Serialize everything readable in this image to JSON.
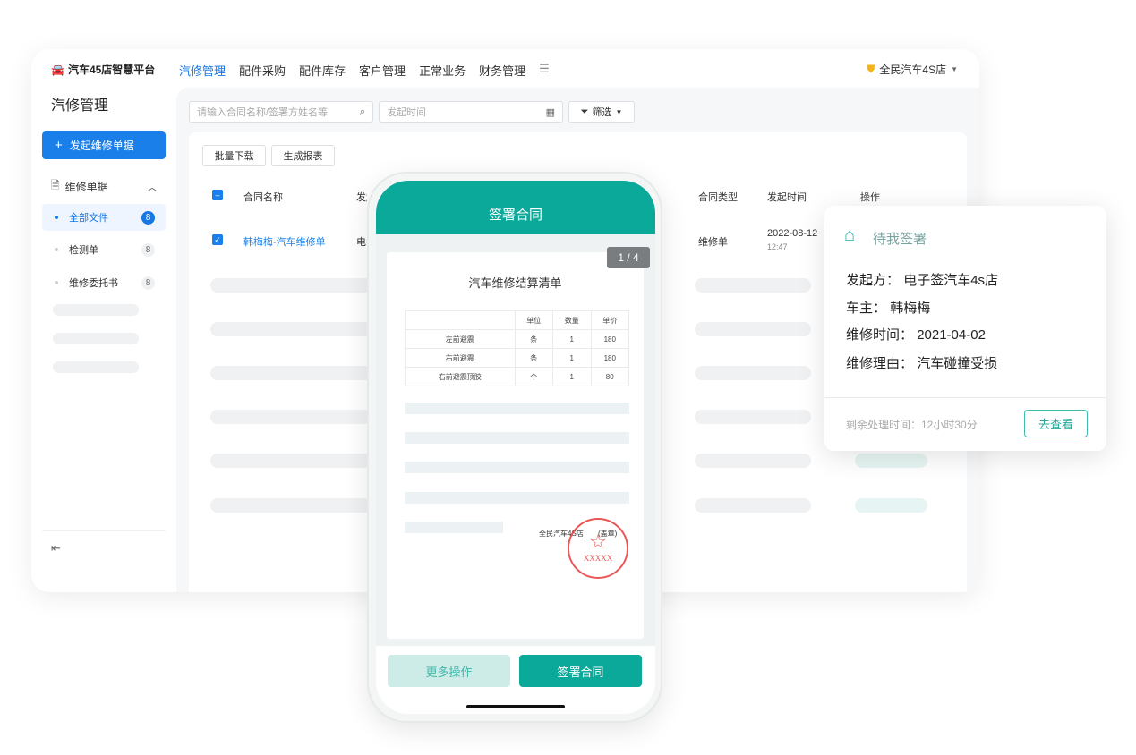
{
  "app": {
    "title": "汽车45店智慧平台",
    "nav": [
      "汽修管理",
      "配件采购",
      "配件库存",
      "客户管理",
      "正常业务",
      "财务管理"
    ],
    "shop": "全民汽车4S店"
  },
  "sidebar": {
    "title": "汽修管理",
    "new_button": "发起维修单据",
    "group": "维修单据",
    "items": [
      {
        "label": "全部文件",
        "count": "8"
      },
      {
        "label": "检测单",
        "count": "8"
      },
      {
        "label": "维修委托书",
        "count": "8"
      }
    ]
  },
  "filters": {
    "search_placeholder": "请输入合同名称/签署方姓名等",
    "date_placeholder": "发起时间",
    "filter": "筛选"
  },
  "toolbar": {
    "batch_download": "批量下载",
    "report": "生成报表"
  },
  "table": {
    "headers": [
      "合同名称",
      "发起方",
      "合同类型",
      "发起时间",
      "操作"
    ],
    "row": {
      "name": "韩梅梅-汽车维修单",
      "initiator": "电子签汽车4s店",
      "type": "维修单",
      "date": "2022-08-12",
      "time": "12:47"
    }
  },
  "phone": {
    "title": "签署合同",
    "pager": "1 / 4",
    "doc_title": "汽车维修结算清单",
    "doc_headers": [
      "",
      "单位",
      "数量",
      "单价"
    ],
    "doc_rows": [
      [
        "左前避震",
        "条",
        "1",
        "180"
      ],
      [
        "右前避震",
        "条",
        "1",
        "180"
      ],
      [
        "右前避震顶胶",
        "个",
        "1",
        "80"
      ]
    ],
    "signer": "全民汽车4S店",
    "seal_label": "(盖章)",
    "seal_text": "XXXXX",
    "more": "更多操作",
    "sign": "签署合同"
  },
  "popup": {
    "title": "待我签署",
    "fields": [
      {
        "k": "发起方：",
        "v": "电子签汽车4s店"
      },
      {
        "k": "车主：",
        "v": "韩梅梅"
      },
      {
        "k": "维修时间：",
        "v": "2021-04-02"
      },
      {
        "k": "维修理由：",
        "v": "汽车碰撞受损"
      }
    ],
    "remaining": "剩余处理时间：12小时30分",
    "view": "去查看"
  },
  "colors": {
    "primary": "#1a7fe8",
    "teal": "#0ba99a",
    "seal": "#e83a3a"
  }
}
